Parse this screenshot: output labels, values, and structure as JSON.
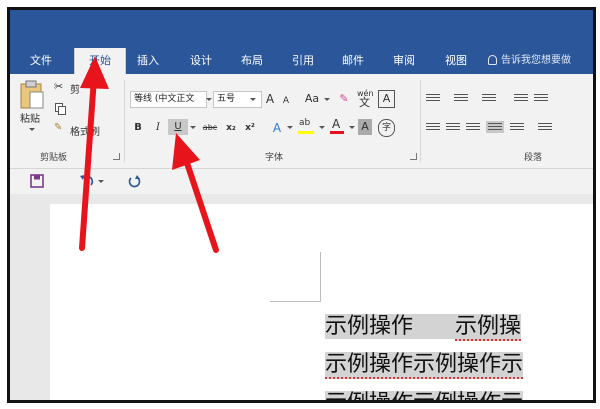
{
  "tabs": [
    "文件",
    "开始",
    "插入",
    "设计",
    "布局",
    "引用",
    "邮件",
    "审阅",
    "视图"
  ],
  "active_tab": "开始",
  "tell_me": "告诉我您想要做",
  "clipboard": {
    "paste_label": "粘贴",
    "cut_label": "剪",
    "format_painter_label": "格式刷",
    "group_label": "剪贴板"
  },
  "font": {
    "font_name": "等线 (中文正文",
    "font_size": "五号",
    "grow": "A",
    "shrink": "A",
    "case": "Aa",
    "pinyin_top": "wén",
    "pinyin_bottom": "文",
    "char_border": "A",
    "bold": "B",
    "italic": "I",
    "underline": "U",
    "strikethrough": "abc",
    "subscript": "x₂",
    "superscript": "x²",
    "text_effects": "A",
    "highlight": "ab",
    "font_color": "A",
    "char_shading": "A",
    "enclose": "字",
    "group_label": "字体"
  },
  "paragraph": {
    "group_label": "段落"
  },
  "document": {
    "line1_part1": "示例操作",
    "line1_part2": "示例操",
    "line2": "示例操作示例操作示",
    "line3": "示例操作示例操作示"
  },
  "colors": {
    "ribbon_blue": "#2b579a",
    "arrow_red": "#e8141b",
    "font_color_bar": "#e81123",
    "highlight_bar": "#ffff00"
  }
}
